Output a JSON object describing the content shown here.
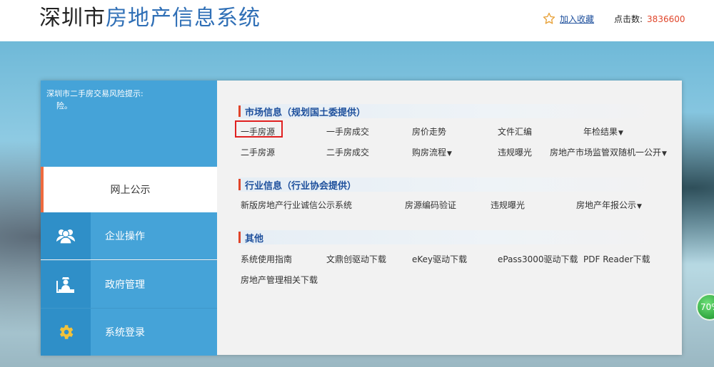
{
  "header": {
    "title_part1": "深圳市",
    "title_part2": "房地产信息系统",
    "favorite_label": "加入收藏",
    "clicks_label": "点击数:",
    "clicks_value": "3836600"
  },
  "sidebar": {
    "notice_line1": "深圳市二手房交易风险提示:",
    "notice_line2": "险。",
    "active_item": "网上公示",
    "items": [
      {
        "label": "企业操作",
        "icon": "users-icon"
      },
      {
        "label": "政府管理",
        "icon": "officer-desk-icon"
      },
      {
        "label": "系统登录",
        "icon": "gear-icon"
      }
    ]
  },
  "sections": [
    {
      "title": "市场信息（规划国土委提供）",
      "rows": [
        [
          "一手房源",
          "一手房成交",
          "房价走势",
          "文件汇编",
          "年检结果"
        ],
        [
          "二手房源",
          "二手房成交",
          "购房流程",
          "违规曝光",
          "房地产市场监管双随机一公开"
        ]
      ]
    },
    {
      "title": "行业信息（行业协会提供）",
      "rows": [
        [
          "新版房地产行业诚信公示系统",
          "房源编码验证",
          "违规曝光",
          "房地产年报公示"
        ]
      ]
    },
    {
      "title": "其他",
      "rows": [
        [
          "系统使用指南",
          "文鼎创驱动下载",
          "eKey驱动下载",
          "ePass3000驱动下载",
          "PDF Reader下载"
        ],
        [
          "房地产管理相关下载"
        ]
      ]
    }
  ],
  "badge": {
    "value": "70%"
  },
  "colors": {
    "accent_blue": "#45a3d8",
    "title_blue": "#1d4f9c",
    "accent_red": "#e0452a"
  }
}
